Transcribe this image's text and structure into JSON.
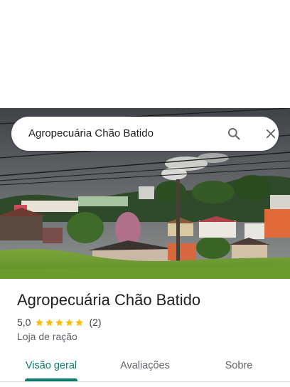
{
  "search": {
    "query": "Agropecuária Chão Batido",
    "search_icon": "search-icon",
    "close_icon": "close-icon"
  },
  "place": {
    "name": "Agropecuária Chão Batido",
    "rating": "5,0",
    "stars": 5,
    "review_count": "(2)",
    "category": "Loja de ração"
  },
  "tabs": [
    {
      "label": "Visão geral",
      "selected": true
    },
    {
      "label": "Avaliações",
      "selected": false
    },
    {
      "label": "Sobre",
      "selected": false
    }
  ],
  "colors": {
    "accent": "#0b7a6b",
    "star": "#fbbc04"
  }
}
